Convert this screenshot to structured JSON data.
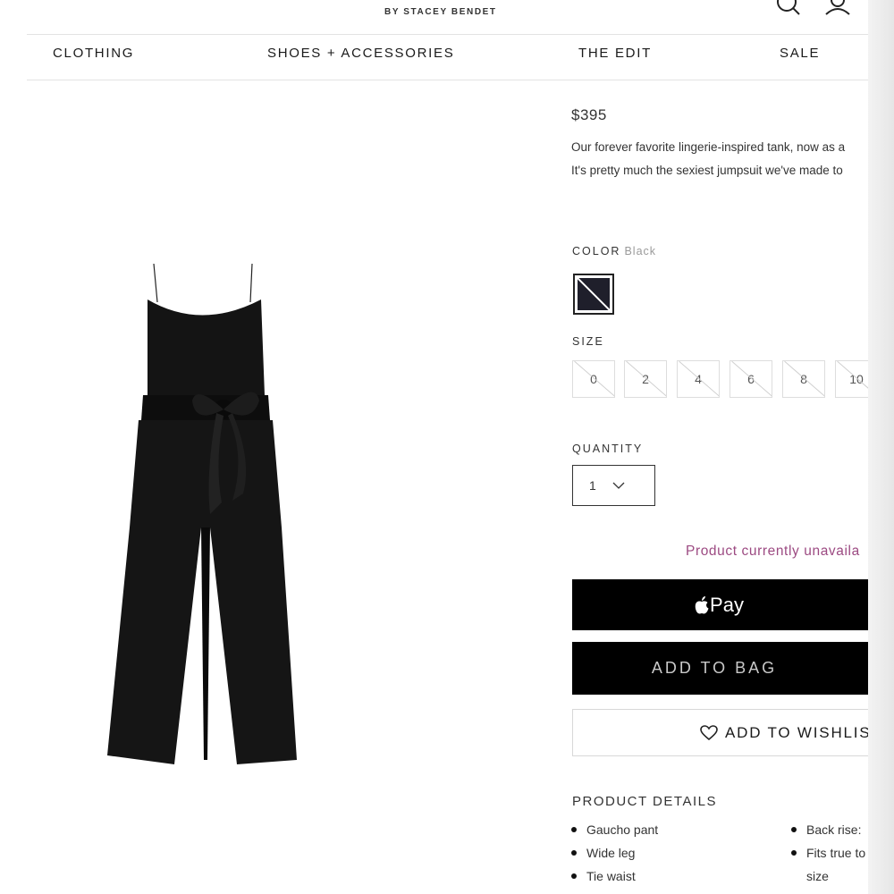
{
  "header": {
    "brand_sub": "BY STACEY BENDET"
  },
  "icons": [
    "search-icon",
    "account-icon",
    "apple-logo-icon",
    "heart-icon",
    "chevron-down-icon"
  ],
  "nav": {
    "items": [
      "CLOTHING",
      "SHOES + ACCESSORIES",
      "THE EDIT",
      "SALE"
    ]
  },
  "product": {
    "price": "$395",
    "description_line1": "Our forever favorite lingerie-inspired tank, now as a",
    "description_line2": "It's pretty much the sexiest jumpsuit we've made to",
    "color_label": "COLOR",
    "color_value": "Black",
    "color_swatch": "#1f1f2b",
    "size_label": "SIZE",
    "sizes": [
      "0",
      "2",
      "4",
      "6",
      "8",
      "10"
    ],
    "quantity_label": "QUANTITY",
    "quantity_value": "1",
    "availability": "Product currently unavaila",
    "apple_pay_label": "Pay",
    "add_to_bag_label": "ADD TO BAG",
    "wishlist_label": "ADD TO WISHLIS",
    "details_title": "PRODUCT DETAILS",
    "details_left": [
      "Gaucho pant",
      "Wide leg",
      "Tie waist"
    ],
    "details_right": [
      "Back rise:",
      "Fits true to",
      "size"
    ]
  },
  "colors": {
    "availability_text": "#9c4a82",
    "button_bg": "#000000"
  }
}
